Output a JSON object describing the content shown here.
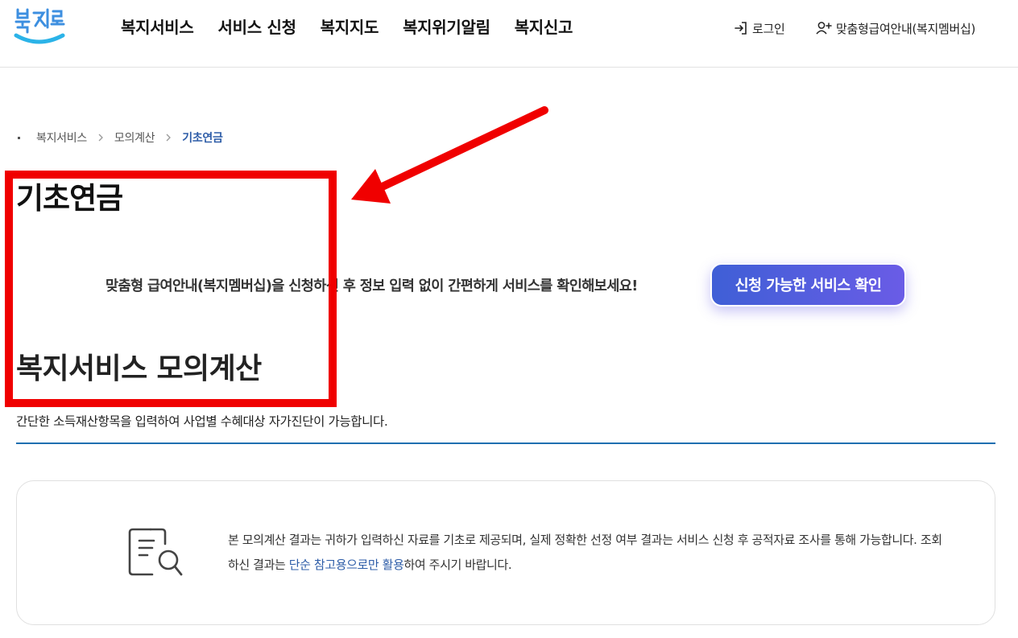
{
  "header": {
    "logo_alt": "복지로",
    "logo_colors": {
      "text": "#3d8fe0",
      "smile": "#2bb3e8"
    },
    "nav": [
      {
        "label": "복지서비스"
      },
      {
        "label": "서비스 신청"
      },
      {
        "label": "복지지도"
      },
      {
        "label": "복지위기알림"
      },
      {
        "label": "복지신고"
      }
    ],
    "login_label": "로그인",
    "login_icon": "login-icon",
    "member_label": "맞춤형급여안내(복지멤버십)",
    "member_icon": "user-add-icon"
  },
  "breadcrumb": {
    "items": [
      "복지서비스",
      "모의계산"
    ],
    "current": "기초연금"
  },
  "page_title": "기초연금",
  "promo": {
    "text": "맞춤형 급여안내(복지멤버십)을 신청하신 후 정보 입력 없이 간편하게 서비스를 확인해보세요!",
    "button_label": "신청 가능한 서비스 확인",
    "button_gradient": [
      "#3f5fd6",
      "#6a5ce6"
    ]
  },
  "section": {
    "title": "복지서비스 모의계산",
    "description": "간단한 소득재산항목을 입력하여 사업별 수혜대상 자가진단이 가능합니다.",
    "accent_color": "#1f6fb0"
  },
  "notice": {
    "icon": "document-search-icon",
    "text_before": "본 모의계산 결과는 귀하가 입력하신 자료를 기초로 제공되며, 실제 정확한 선정 여부 결과는 서비스 신청 후 공적자료 조사를 통해 가능합니다. 조회하신 결과는 ",
    "text_highlight": "단순 참고용으로만 활용",
    "text_after": "하여 주시기 바랍니다."
  },
  "annotation": {
    "color": "#f00000"
  }
}
